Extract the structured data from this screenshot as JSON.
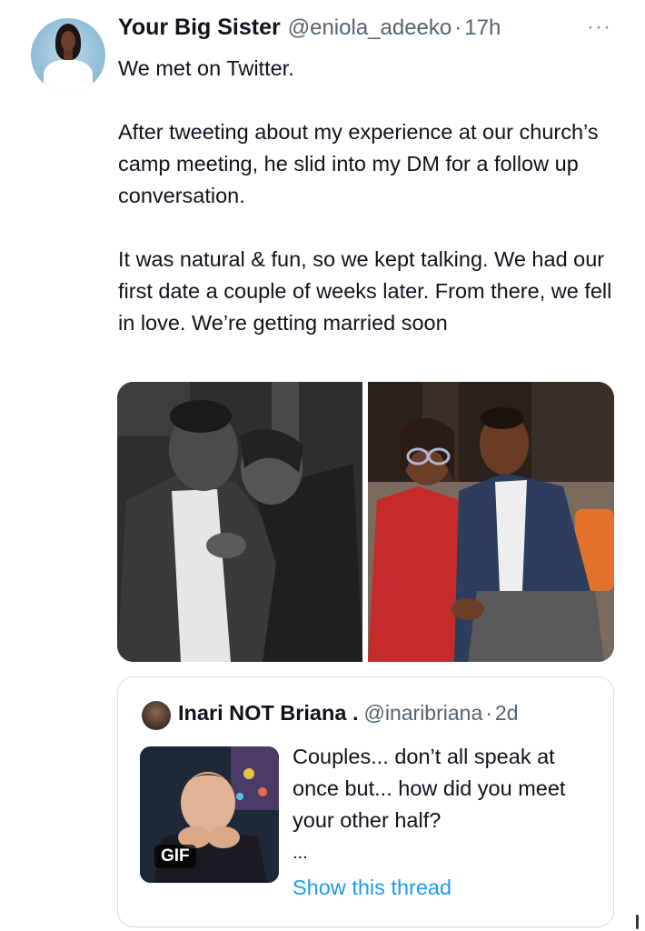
{
  "tweet": {
    "author_name": "Your Big Sister",
    "handle": "@eniola_adeeko",
    "separator": "·",
    "time": "17h",
    "more_icon": "···",
    "paragraphs": [
      "We met on Twitter.",
      "After tweeting about my experience at our church’s camp meeting, he slid into my DM for a follow up conversation.",
      "It was natural & fun, so we kept talking.  We had our first date a couple of weeks later. From there, we fell in love. We’re getting married soon"
    ]
  },
  "quoted": {
    "author_name": "Inari NOT Briana .",
    "handle": "@inaribriana",
    "separator": "·",
    "time": "2d",
    "gif_badge": "GIF",
    "text": "Couples... don’t all speak at once but... how did you meet your other half?",
    "ellipsis": "...",
    "show_thread": "Show this thread"
  },
  "colors": {
    "link": "#1d9bf0",
    "secondary_text": "#536471",
    "border": "#d6dde3"
  }
}
